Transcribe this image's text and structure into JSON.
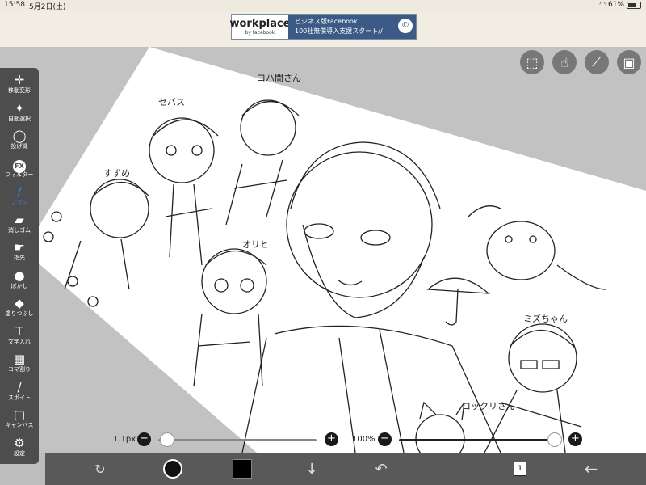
{
  "status_bar": {
    "time": "15:58",
    "date": "5月2日(土)",
    "battery": "61%",
    "battery_level": 0.61
  },
  "ad": {
    "logo": "workplace",
    "by": "by facebook",
    "line1": "ビジネス版Facebook",
    "line2": "100社無償導入支援スタート//",
    "badge": "©"
  },
  "tools": [
    {
      "label": "移動変形",
      "icon": "move-icon",
      "glyph": "✛"
    },
    {
      "label": "自動選択",
      "icon": "magic-wand-icon",
      "glyph": "✦"
    },
    {
      "label": "投げ縄",
      "icon": "lasso-icon",
      "glyph": "◯"
    },
    {
      "label": "フィルター",
      "icon": "filter-fx-icon",
      "glyph": "FX"
    },
    {
      "label": "ブラシ",
      "icon": "brush-icon",
      "glyph": "∕",
      "active": true
    },
    {
      "label": "消しゴム",
      "icon": "eraser-icon",
      "glyph": "▰"
    },
    {
      "label": "指先",
      "icon": "finger-icon",
      "glyph": "☛"
    },
    {
      "label": "ぼかし",
      "icon": "blur-drop-icon",
      "glyph": "●"
    },
    {
      "label": "塗りつぶし",
      "icon": "fill-bucket-icon",
      "glyph": "◆"
    },
    {
      "label": "文字入れ",
      "icon": "text-icon",
      "glyph": "T"
    },
    {
      "label": "コマ割り",
      "icon": "panel-divide-icon",
      "glyph": "▦"
    },
    {
      "label": "スポイト",
      "icon": "eyedropper-icon",
      "glyph": "∕"
    },
    {
      "label": "キャンバス",
      "icon": "canvas-icon",
      "glyph": "▢"
    },
    {
      "label": "設定",
      "icon": "gear-icon",
      "glyph": "⚙"
    }
  ],
  "top_buttons": [
    {
      "name": "selection-icon",
      "glyph": "⬚"
    },
    {
      "name": "touch-icon",
      "glyph": "☝"
    },
    {
      "name": "ruler-icon",
      "glyph": "⟋"
    },
    {
      "name": "image-icon",
      "glyph": "▣"
    }
  ],
  "brush_size": {
    "label": "1.1px",
    "value": 1.1
  },
  "opacity": {
    "label": "100%",
    "value": 1.0
  },
  "bottom_bar": {
    "layer_count": "1",
    "colors": {
      "bar": "#595959",
      "accent": "#2d8ae8"
    }
  },
  "canvas_text": {
    "t1": "セバス",
    "t2": "コハ間さん",
    "t3": "すずめ",
    "t4": "オリヒ",
    "t5": "コックリさん",
    "t6": "ミズちゃん"
  }
}
